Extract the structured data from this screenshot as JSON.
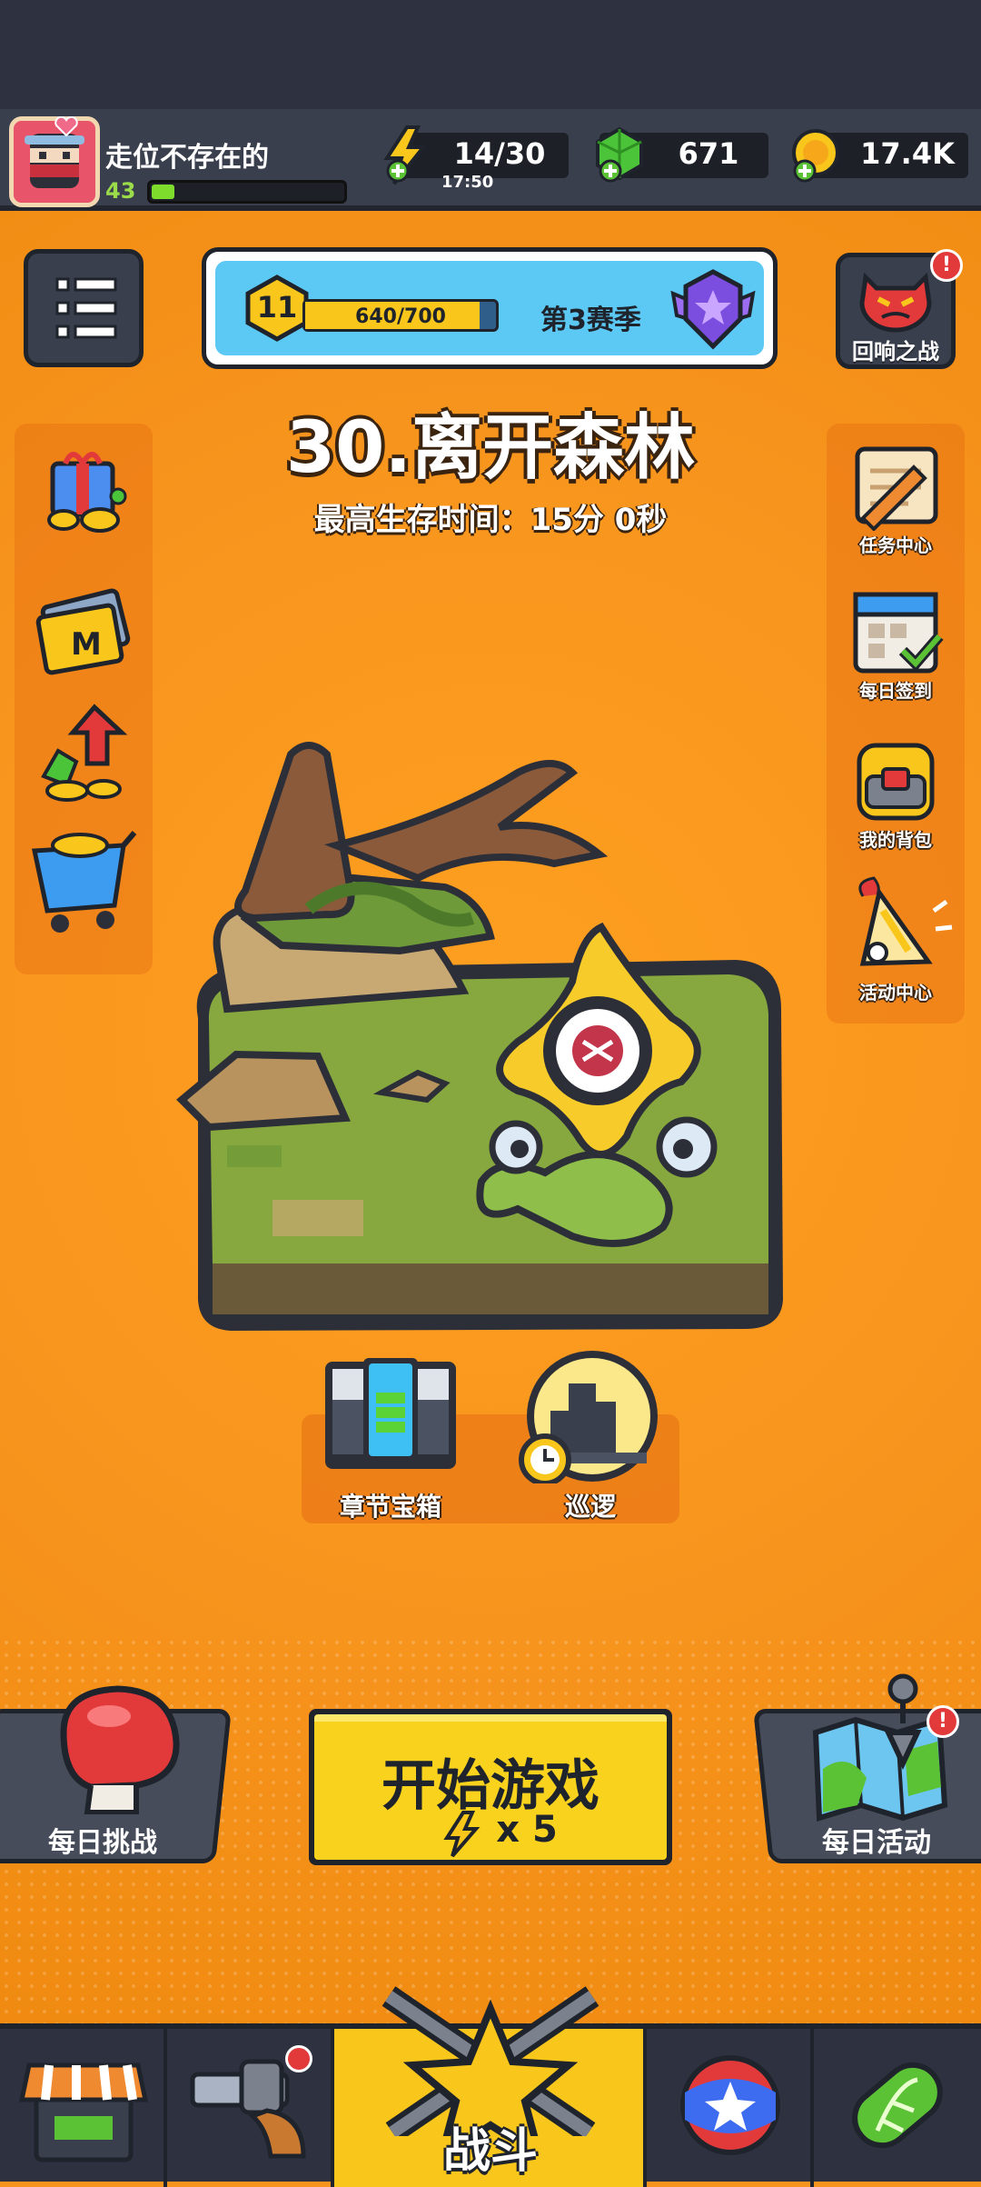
{
  "player": {
    "name": "走位不存在的",
    "level": "43",
    "xp_progress": 0.12
  },
  "resources": {
    "energy": {
      "value": "14/30",
      "timer": "17:50"
    },
    "gems": {
      "value": "671"
    },
    "coins": {
      "value": "17.4K"
    }
  },
  "season": {
    "level": "11",
    "progress_text": "640/700",
    "progress": 0.914,
    "label": "第3赛季"
  },
  "echo_battle": {
    "label": "回响之战",
    "badge": "!"
  },
  "stage": {
    "title": "30.离开森林",
    "best_survival": "最高生存时间：15分 0秒"
  },
  "left_icons": [
    {
      "icon": "gift-coins-icon"
    },
    {
      "icon": "monthly-card-icon"
    },
    {
      "icon": "gem-growth-icon"
    },
    {
      "icon": "shop-cart-icon"
    }
  ],
  "right_menu": [
    {
      "label": "任务中心",
      "icon": "quest-scroll-icon"
    },
    {
      "label": "每日签到",
      "icon": "calendar-check-icon"
    },
    {
      "label": "我的背包",
      "icon": "backpack-icon"
    },
    {
      "label": "活动中心",
      "icon": "party-horn-icon"
    }
  ],
  "sub_actions": {
    "chest_label": "章节宝箱",
    "patrol_label": "巡逻"
  },
  "daily_challenge": {
    "label": "每日挑战"
  },
  "daily_event": {
    "label": "每日活动",
    "badge": "!"
  },
  "start": {
    "label": "开始游戏",
    "cost": "x 5"
  },
  "bottom_nav": {
    "battle_label": "战斗"
  },
  "colors": {
    "background": "#f7941d",
    "accent": "#f9c71b",
    "dark": "#1f232b"
  }
}
